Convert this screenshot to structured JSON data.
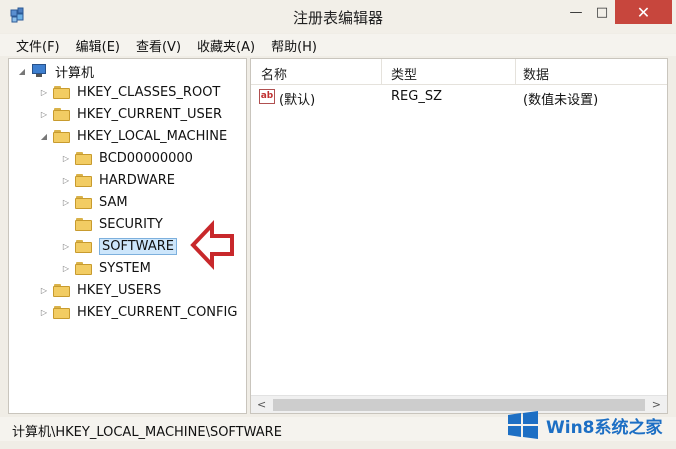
{
  "window": {
    "title": "注册表编辑器",
    "controls": {
      "minimize": "—",
      "maximize": "□",
      "close": "✕"
    }
  },
  "menu": [
    "文件(F)",
    "编辑(E)",
    "查看(V)",
    "收藏夹(A)",
    "帮助(H)"
  ],
  "tree": {
    "root": "计算机",
    "hives": [
      {
        "label": "HKEY_CLASSES_ROOT",
        "expander": "▷"
      },
      {
        "label": "HKEY_CURRENT_USER",
        "expander": "▷"
      },
      {
        "label": "HKEY_LOCAL_MACHINE",
        "expander": "◢",
        "children": [
          {
            "label": "BCD00000000",
            "expander": "▷"
          },
          {
            "label": "HARDWARE",
            "expander": "▷"
          },
          {
            "label": "SAM",
            "expander": "▷"
          },
          {
            "label": "SECURITY",
            "expander": ""
          },
          {
            "label": "SOFTWARE",
            "expander": "▷",
            "selected": true
          },
          {
            "label": "SYSTEM",
            "expander": "▷"
          }
        ]
      },
      {
        "label": "HKEY_USERS",
        "expander": "▷"
      },
      {
        "label": "HKEY_CURRENT_CONFIG",
        "expander": "▷"
      }
    ]
  },
  "list": {
    "columns": [
      "名称",
      "类型",
      "数据"
    ],
    "rows": [
      {
        "icon": "ab",
        "name": "(默认)",
        "type": "REG_SZ",
        "data": "(数值未设置)"
      }
    ]
  },
  "scrollbar": {
    "left": "<",
    "right": ">"
  },
  "status": "计算机\\HKEY_LOCAL_MACHINE\\SOFTWARE",
  "watermark": {
    "text": "Win8系统之家"
  },
  "colors": {
    "close": "#c7463d",
    "selection": "#cde6fb",
    "arrow": "#c8282b",
    "watermark": "#1d6fc4"
  }
}
